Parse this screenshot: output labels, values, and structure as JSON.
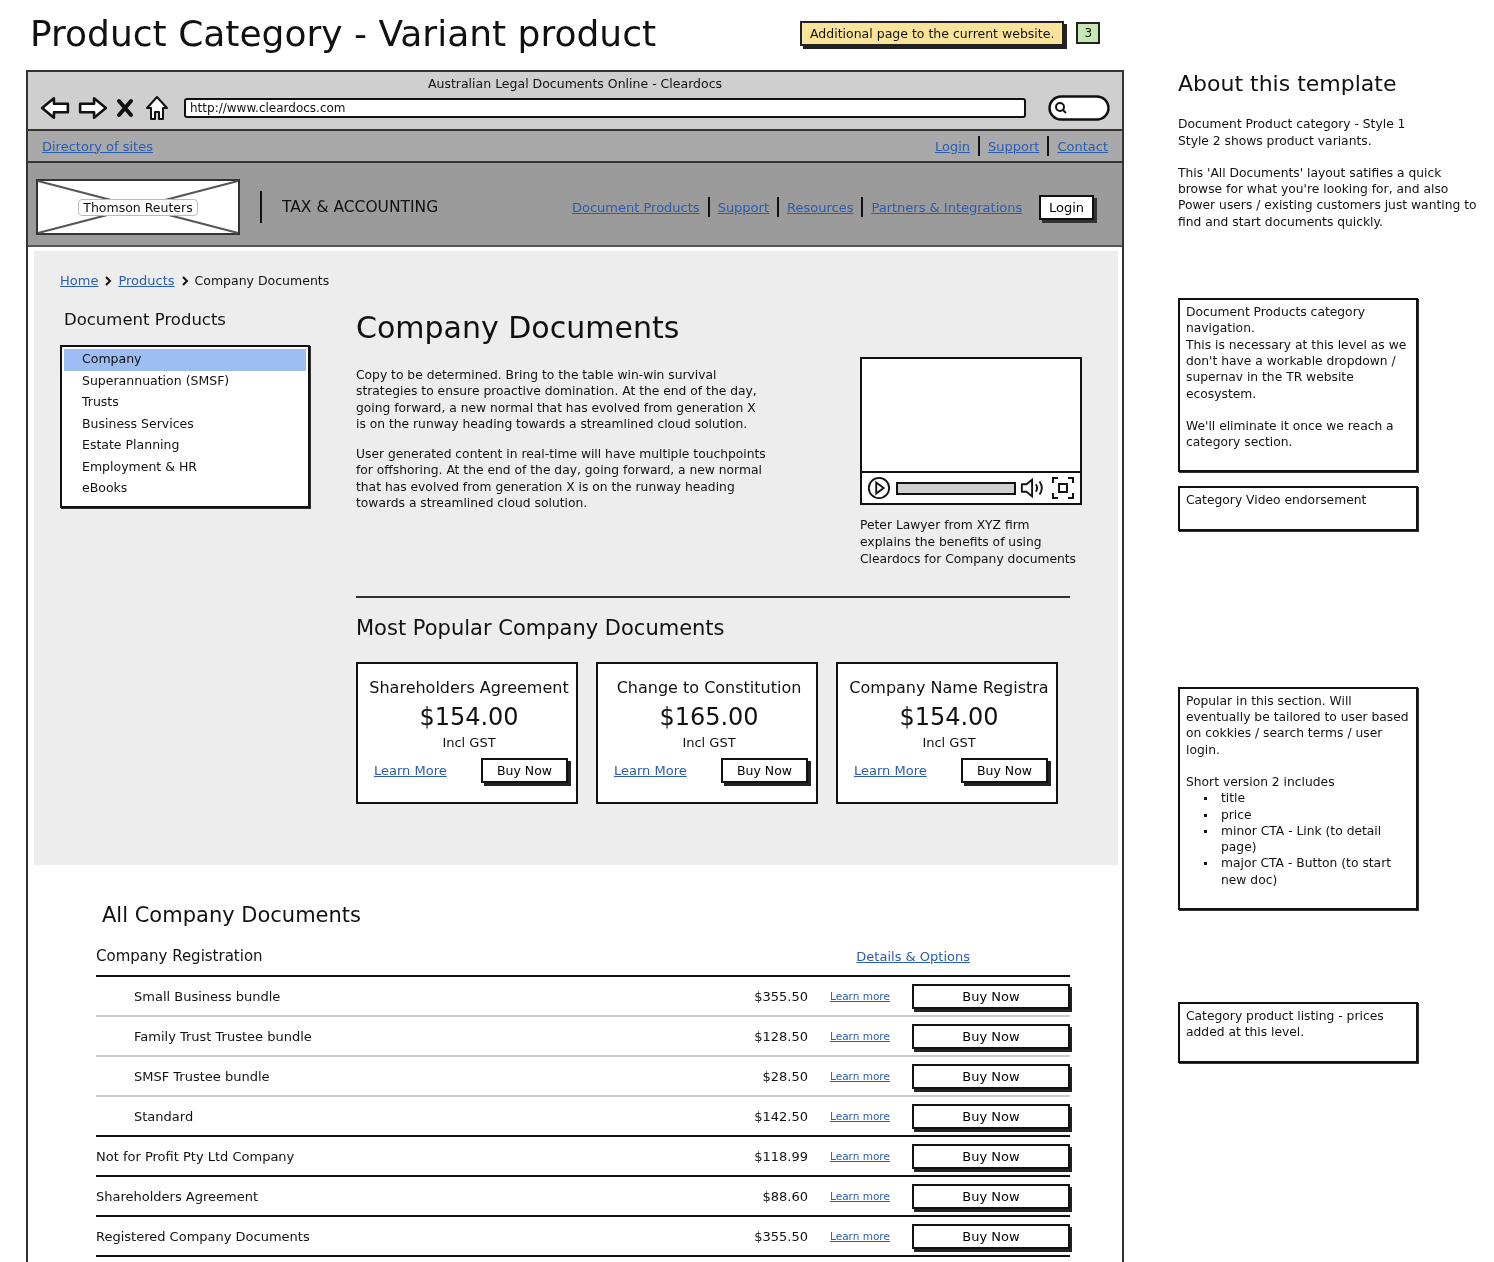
{
  "title": "Product Category - Variant product",
  "badge": {
    "text": "Additional page to the current website.",
    "number": "3"
  },
  "browser": {
    "title": "Australian Legal Documents Online - Cleardocs",
    "url": "http://www.cleardocs.com",
    "left_link": "Directory of sites",
    "right_links": [
      "Login",
      "Support",
      "Contact"
    ]
  },
  "site_header": {
    "logo": "Thomson Reuters",
    "brand": "TAX & ACCOUNTING",
    "nav": [
      "Document Products",
      "Support",
      "Resources",
      "Partners & Integrations"
    ],
    "login": "Login"
  },
  "breadcrumb": [
    {
      "label": "Home",
      "link": true
    },
    {
      "label": "Products",
      "link": true
    },
    {
      "label": "Company Documents",
      "link": false
    }
  ],
  "sidebar": {
    "title": "Document Products",
    "items": [
      {
        "label": "Company",
        "selected": true
      },
      {
        "label": "Superannuation (SMSF)",
        "selected": false
      },
      {
        "label": "Trusts",
        "selected": false
      },
      {
        "label": "Business Services",
        "selected": false
      },
      {
        "label": "Estate Planning",
        "selected": false
      },
      {
        "label": "Employment & HR",
        "selected": false
      },
      {
        "label": "eBooks",
        "selected": false
      }
    ]
  },
  "main": {
    "title": "Company Documents",
    "paragraphs": [
      "Copy to be determined. Bring to the table win-win survival strategies to ensure proactive domination. At the end of the day, going forward, a new normal that has evolved from generation X is on the runway heading towards a streamlined cloud solution.",
      "User generated content in real-time will have multiple touchpoints for offshoring. At the end of the day, going forward, a new normal that has evolved from generation X is on the runway heading towards a streamlined cloud solution."
    ]
  },
  "video": {
    "level": 1,
    "caption": "Peter Lawyer from XYZ firm explains the benefits of using Cleardocs for Company documents"
  },
  "popular": {
    "title": "Most Popular Company Documents",
    "cards": [
      {
        "title": "Shareholders Agreement",
        "price": "$154.00",
        "tax_note": "Incl GST",
        "link": "Learn More",
        "button": "Buy Now"
      },
      {
        "title": "Change to Constitution",
        "price": "$165.00",
        "tax_note": "Incl GST",
        "link": "Learn More",
        "button": "Buy Now"
      },
      {
        "title": "Company Name Registra",
        "price": "$154.00",
        "tax_note": "Incl GST",
        "link": "Learn More",
        "button": "Buy Now"
      }
    ]
  },
  "all": {
    "title": "All Company Documents",
    "rows": [
      {
        "name": "Company Registration",
        "link": "Details & Options",
        "children": [
          {
            "name": "Small Business bundle",
            "price": "$355.50",
            "link": "Learn more",
            "button": "Buy Now"
          },
          {
            "name": "Family Trust Trustee bundle",
            "price": "$128.50",
            "link": "Learn more",
            "button": "Buy Now"
          },
          {
            "name": "SMSF Trustee bundle",
            "price": "$28.50",
            "link": "Learn more",
            "button": "Buy Now"
          },
          {
            "name": "Standard",
            "price": "$142.50",
            "link": "Learn more",
            "button": "Buy Now"
          }
        ]
      },
      {
        "name": "Not for Profit Pty Ltd Company",
        "price": "$118.99",
        "link": "Learn more",
        "button": "Buy Now"
      },
      {
        "name": "Shareholders Agreement",
        "price": "$88.60",
        "link": "Learn more",
        "button": "Buy Now"
      },
      {
        "name": "Registered Company Documents",
        "price": "$355.50",
        "link": "Learn more",
        "button": "Buy Now"
      }
    ]
  },
  "about": {
    "title": "About this template",
    "blocks": [
      [
        "Document Product category - Style 1",
        "Style 2 shows product variants."
      ],
      [
        "This 'All Documents' layout satifies a quick browse for what you're looking for, and also Power users / existing customers just wanting to find and start documents quickly."
      ]
    ]
  },
  "notes": [
    {
      "blocks": [
        [
          "Document Products category navigation.",
          "This is necessary at this level as we don't have a workable dropdown / supernav in the TR website ecosystem."
        ],
        [
          "We'll eliminate it once we reach a category section."
        ]
      ]
    },
    {
      "blocks": [
        [
          "Category Video endorsement"
        ]
      ]
    },
    {
      "blocks": [
        [
          "Popular in this section. Will eventually be tailored to user based on cokkies / search terms / user login."
        ],
        [
          "Short version 2 includes"
        ]
      ],
      "bullets": [
        "title",
        "price",
        "minor CTA - Link (to detail page)",
        "major CTA - Button (to start new doc)"
      ]
    },
    {
      "blocks": [
        [
          "Category product listing - prices added at this level."
        ]
      ]
    }
  ]
}
